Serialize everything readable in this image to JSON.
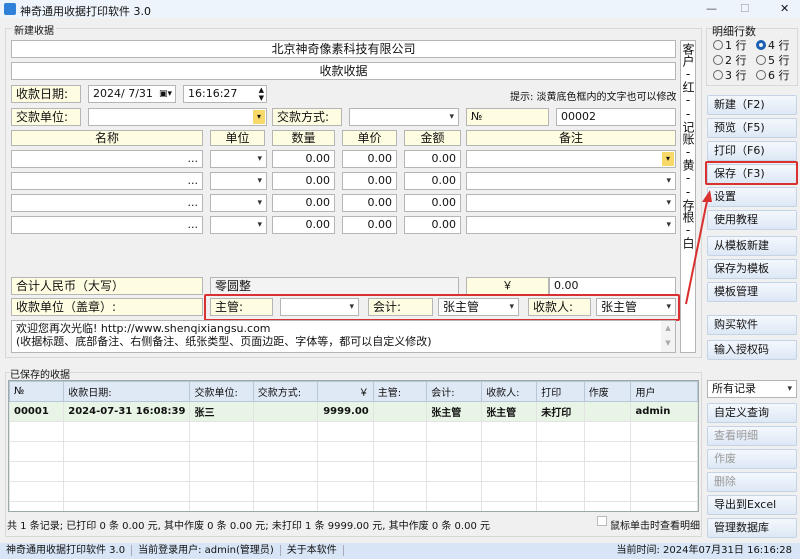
{
  "window": {
    "title": "神奇通用收据打印软件 3.0",
    "minimize": "—",
    "maximize": "☐",
    "close": "✕"
  },
  "form": {
    "group": "新建收据",
    "company": "北京神奇像素科技有限公司",
    "receipt_title": "收款收据",
    "date_label": "收款日期:",
    "date": "2024/ 7/31",
    "time": "16:16:27",
    "hint": "提示: 淡黄底色框内的文字也可以修改",
    "payer_label": "交款单位:",
    "payer": "",
    "method_label": "交款方式:",
    "method": "",
    "no_label": "№",
    "no": "00002",
    "headers": [
      "名称",
      "单位",
      "数量",
      "单价",
      "金额",
      "备注"
    ],
    "rows": [
      {
        "name": "...",
        "qty": "0.00",
        "price": "0.00",
        "amount": "0.00"
      },
      {
        "name": "...",
        "qty": "0.00",
        "price": "0.00",
        "amount": "0.00"
      },
      {
        "name": "...",
        "qty": "0.00",
        "price": "0.00",
        "amount": "0.00"
      },
      {
        "name": "...",
        "qty": "0.00",
        "price": "0.00",
        "amount": "0.00"
      }
    ],
    "total_label": "合计人民币（大写）",
    "total_words": "零圆整",
    "yen": "￥",
    "total": "0.00",
    "seal_label": "收款单位（盖章）:",
    "manager_label": "主管:",
    "manager": "",
    "accountant_label": "会计:",
    "accountant": "张主管",
    "cashier_label": "收款人:",
    "cashier": "张主管",
    "note_line1": "欢迎您再次光临! http://www.shenqixiangsu.com",
    "note_line2": "(收据标题、底部备注、右侧备注、纸张类型、页面边距、字体等，都可以自定义修改)",
    "side_note": "客户-红--记账-黄--存根-白"
  },
  "rows_panel": {
    "label": "明细行数",
    "options": [
      "1 行",
      "4 行",
      "2 行",
      "5 行",
      "3 行",
      "6 行"
    ],
    "selected": "4 行"
  },
  "buttons": [
    "新建（F2)",
    "预览（F5)",
    "打印（F6)",
    "保存（F3)",
    "设置",
    "使用教程",
    "从模板新建",
    "保存为模板",
    "模板管理",
    "购买软件",
    "输入授权码"
  ],
  "saved": {
    "group": "已保存的收据",
    "columns": [
      "№",
      "收款日期:",
      "交款单位:",
      "交款方式:",
      "￥",
      "主管:",
      "会计:",
      "收款人:",
      "打印",
      "作废",
      "用户"
    ],
    "records": [
      [
        "00001",
        "2024-07-31 16:08:39",
        "张三",
        "",
        "9999.00",
        "",
        "张主管",
        "张主管",
        "未打印",
        "",
        "admin"
      ]
    ],
    "summary": "共 1 条记录;  已打印 0 条 0.00 元, 其中作废 0 条 0.00 元;  未打印 1 条 9999.00 元, 其中作废 0 条 0.00 元",
    "click_detail": "鼠标单击时查看明细",
    "filter": "所有记录",
    "actions": [
      "自定义查询",
      "查看明细",
      "作废",
      "删除",
      "导出到Excel",
      "管理数据库"
    ]
  },
  "status": {
    "app": "神奇通用收据打印软件 3.0",
    "user": "当前登录用户: admin(管理员)",
    "about": "关于本软件",
    "time": "当前时间: 2024年07月31日 16:16:28"
  }
}
